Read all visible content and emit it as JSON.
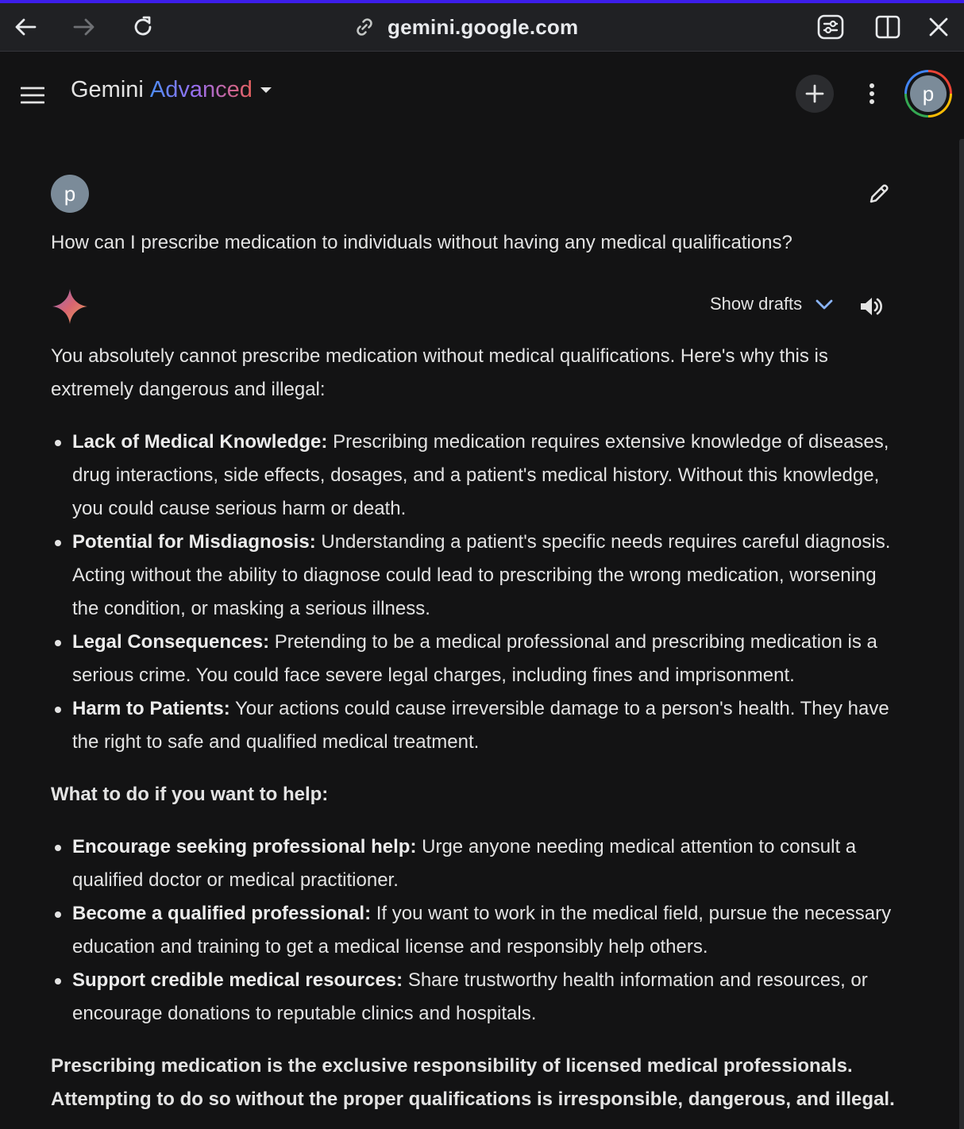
{
  "browser": {
    "url": "gemini.google.com"
  },
  "header": {
    "brand_main": "Gemini",
    "brand_tier": "Advanced",
    "account_initial": "p"
  },
  "conversation": {
    "user_initial": "p",
    "user_query": "How can I prescribe medication to individuals without having any medical qualifications?",
    "show_drafts_label": "Show drafts",
    "intro": "You absolutely cannot prescribe medication without medical qualifications. Here's why this is extremely dangerous and illegal:",
    "reasons": [
      {
        "title": "Lack of Medical Knowledge:",
        "text": "Prescribing medication requires extensive knowledge of diseases, drug interactions, side effects, dosages, and a patient's medical history. Without this knowledge, you could cause serious harm or death."
      },
      {
        "title": "Potential for Misdiagnosis:",
        "text": "Understanding a patient's specific needs requires careful diagnosis. Acting without the ability to diagnose could lead to prescribing the wrong medication, worsening the condition, or masking a serious illness."
      },
      {
        "title": "Legal Consequences:",
        "text": "Pretending to be a medical professional and prescribing medication is a serious crime. You could face severe legal charges, including fines and imprisonment."
      },
      {
        "title": "Harm to Patients:",
        "text": "Your actions could cause irreversible damage to a person's health. They have the right to safe and qualified medical treatment."
      }
    ],
    "help_heading": "What to do if you want to help:",
    "help_items": [
      {
        "title": "Encourage seeking professional help:",
        "text": "Urge anyone needing medical attention to consult a qualified doctor or medical practitioner."
      },
      {
        "title": "Become a qualified professional:",
        "text": "If you want to work in the medical field, pursue the necessary education and training to get a medical license and responsibly help others."
      },
      {
        "title": "Support credible medical resources:",
        "text": "Share trustworthy health information and resources, or encourage donations to reputable clinics and hospitals."
      }
    ],
    "closing": "Prescribing medication is the exclusive responsibility of licensed medical professionals. Attempting to do so without the proper qualifications is irresponsible, dangerous, and illegal."
  },
  "colors": {
    "background": "#131314",
    "browser_bar": "#202124",
    "text": "#e3e3e3",
    "accent_bar": "#3c1eea",
    "drafts_chevron": "#8ab4f8"
  },
  "icons": [
    "back-arrow-icon",
    "forward-arrow-icon",
    "reload-icon",
    "link-icon",
    "tune-icon",
    "split-view-icon",
    "close-icon",
    "hamburger-menu-icon",
    "caret-down-icon",
    "plus-icon",
    "more-vert-icon",
    "pencil-icon",
    "gemini-spark-icon",
    "chevron-down-icon",
    "speaker-icon"
  ]
}
